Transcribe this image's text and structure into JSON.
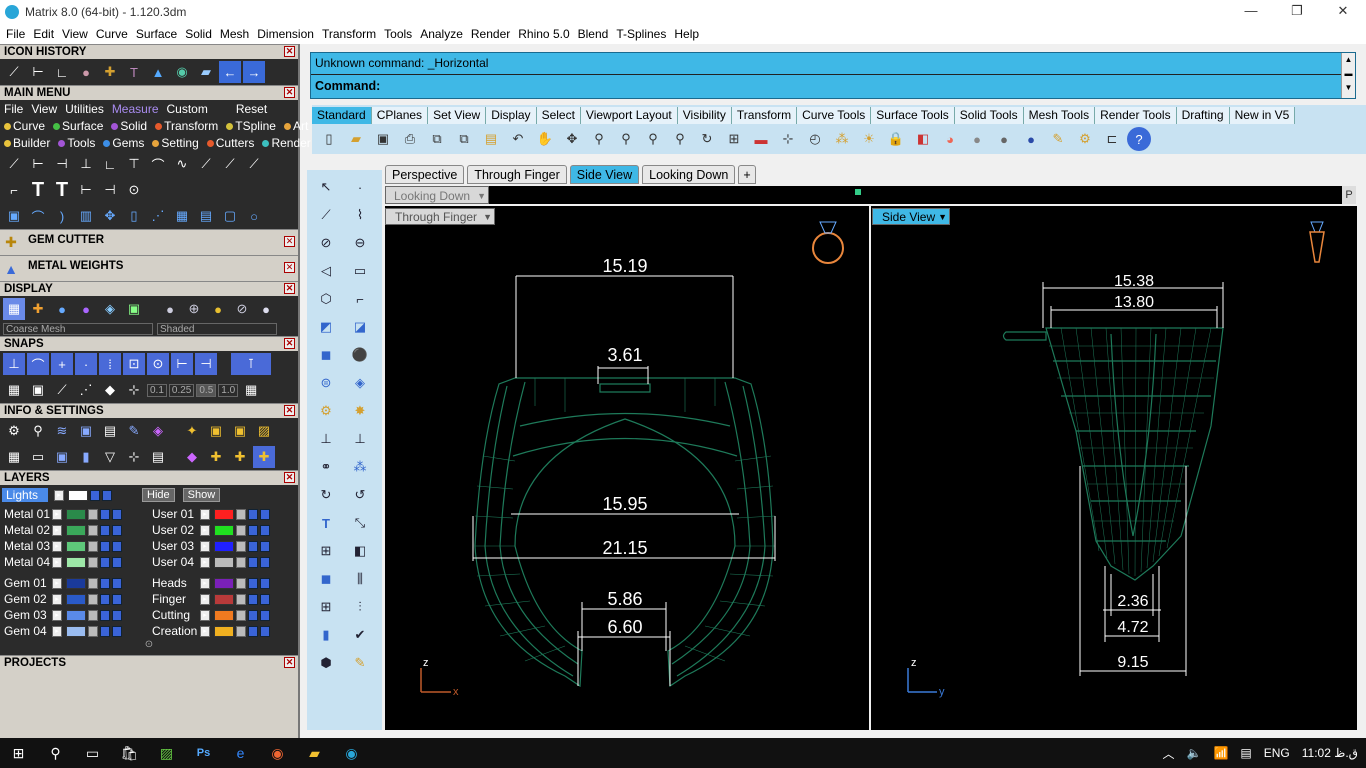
{
  "window": {
    "title": "Matrix 8.0 (64-bit) - 1.120.3dm",
    "minimize": "—",
    "restore": "❐",
    "close": "✕"
  },
  "menu": [
    "File",
    "Edit",
    "View",
    "Curve",
    "Surface",
    "Solid",
    "Mesh",
    "Dimension",
    "Transform",
    "Tools",
    "Analyze",
    "Render",
    "Rhino 5.0",
    "Blend",
    "T-Splines",
    "Help"
  ],
  "panels": {
    "icon_history": "ICON HISTORY",
    "main_menu": "MAIN MENU",
    "main_menu_row1": [
      "File",
      "View",
      "Utilities",
      "Measure",
      "Custom",
      "Reset"
    ],
    "main_menu_row2": [
      {
        "label": "Curve",
        "color": "#e8c33c"
      },
      {
        "label": "Surface",
        "color": "#45c045"
      },
      {
        "label": "Solid",
        "color": "#a355d6"
      },
      {
        "label": "Transform",
        "color": "#e65a2c"
      },
      {
        "label": "TSpline",
        "color": "#d4c23c"
      },
      {
        "label": "Art",
        "color": "#e6a43c"
      }
    ],
    "main_menu_row3": [
      {
        "label": "Builder",
        "color": "#e8c33c"
      },
      {
        "label": "Tools",
        "color": "#a355d6"
      },
      {
        "label": "Gems",
        "color": "#3c8ee6"
      },
      {
        "label": "Setting",
        "color": "#e6a43c"
      },
      {
        "label": "Cutters",
        "color": "#e65a2c"
      },
      {
        "label": "Render",
        "color": "#3cc0c0"
      }
    ],
    "gem_cutter": "GEM CUTTER",
    "metal_weights": "METAL WEIGHTS",
    "display": "DISPLAY",
    "display_left_select": "Coarse Mesh",
    "display_right_select": "Shaded",
    "snaps": "SNAPS",
    "snap_values": [
      "0.1",
      "0.25",
      "0.5",
      "1.0"
    ],
    "info_settings": "INFO & SETTINGS",
    "layers": "LAYERS",
    "lights": "Lights",
    "hide": "Hide",
    "show": "Show",
    "projects": "PROJECTS"
  },
  "layers_left": [
    {
      "name": "Metal 01",
      "color": "#2a8a4a"
    },
    {
      "name": "Metal 02",
      "color": "#3aa85a"
    },
    {
      "name": "Metal 03",
      "color": "#5ec87a"
    },
    {
      "name": "Metal 04",
      "color": "#9ee8a8"
    },
    {
      "name": "Gem 01",
      "color": "#1a3a9a"
    },
    {
      "name": "Gem 02",
      "color": "#2a5ac8"
    },
    {
      "name": "Gem 03",
      "color": "#5a8ae8"
    },
    {
      "name": "Gem 04",
      "color": "#9abcf0"
    }
  ],
  "layers_right": [
    {
      "name": "User 01",
      "color": "#ff2020"
    },
    {
      "name": "User 02",
      "color": "#20e020"
    },
    {
      "name": "User 03",
      "color": "#2020ff"
    },
    {
      "name": "User 04",
      "color": "#bbbbbb"
    },
    {
      "name": "Heads",
      "color": "#7a20b8"
    },
    {
      "name": "Finger",
      "color": "#b83a3a"
    },
    {
      "name": "Cutting",
      "color": "#f07a20"
    },
    {
      "name": "Creation",
      "color": "#f0b020"
    }
  ],
  "command": {
    "history": "Unknown command: _Horizontal",
    "prompt": "Command:"
  },
  "toolbar_tabs": [
    "Standard",
    "CPlanes",
    "Set View",
    "Display",
    "Select",
    "Viewport Layout",
    "Visibility",
    "Transform",
    "Curve Tools",
    "Surface Tools",
    "Solid Tools",
    "Mesh Tools",
    "Render Tools",
    "Drafting",
    "New in V5"
  ],
  "viewport_tabs": [
    "Perspective",
    "Through Finger",
    "Side View",
    "Looking Down",
    "+"
  ],
  "viewports": {
    "top_label": "Looking Down",
    "top_p": "P",
    "left_label": "Through Finger",
    "right_label": "Side View"
  },
  "dims_left": {
    "d1": "15.19",
    "d2": "3.61",
    "d3": "15.95",
    "d4": "21.15",
    "d5": "5.86",
    "d6": "6.60",
    "ax_z": "z",
    "ax_x": "x"
  },
  "dims_right": {
    "d1": "15.38",
    "d2": "13.80",
    "d3": "2.36",
    "d4": "4.72",
    "d5": "9.15",
    "ax_z": "z",
    "ax_y": "y"
  },
  "taskbar": {
    "lang": "ENG",
    "time": "11:02 ق.ظ"
  },
  "colors": {
    "accent": "#3fb8e6",
    "wire": "#1e7a5a",
    "dim": "#ffffff",
    "panel": "#2b2b2b"
  }
}
